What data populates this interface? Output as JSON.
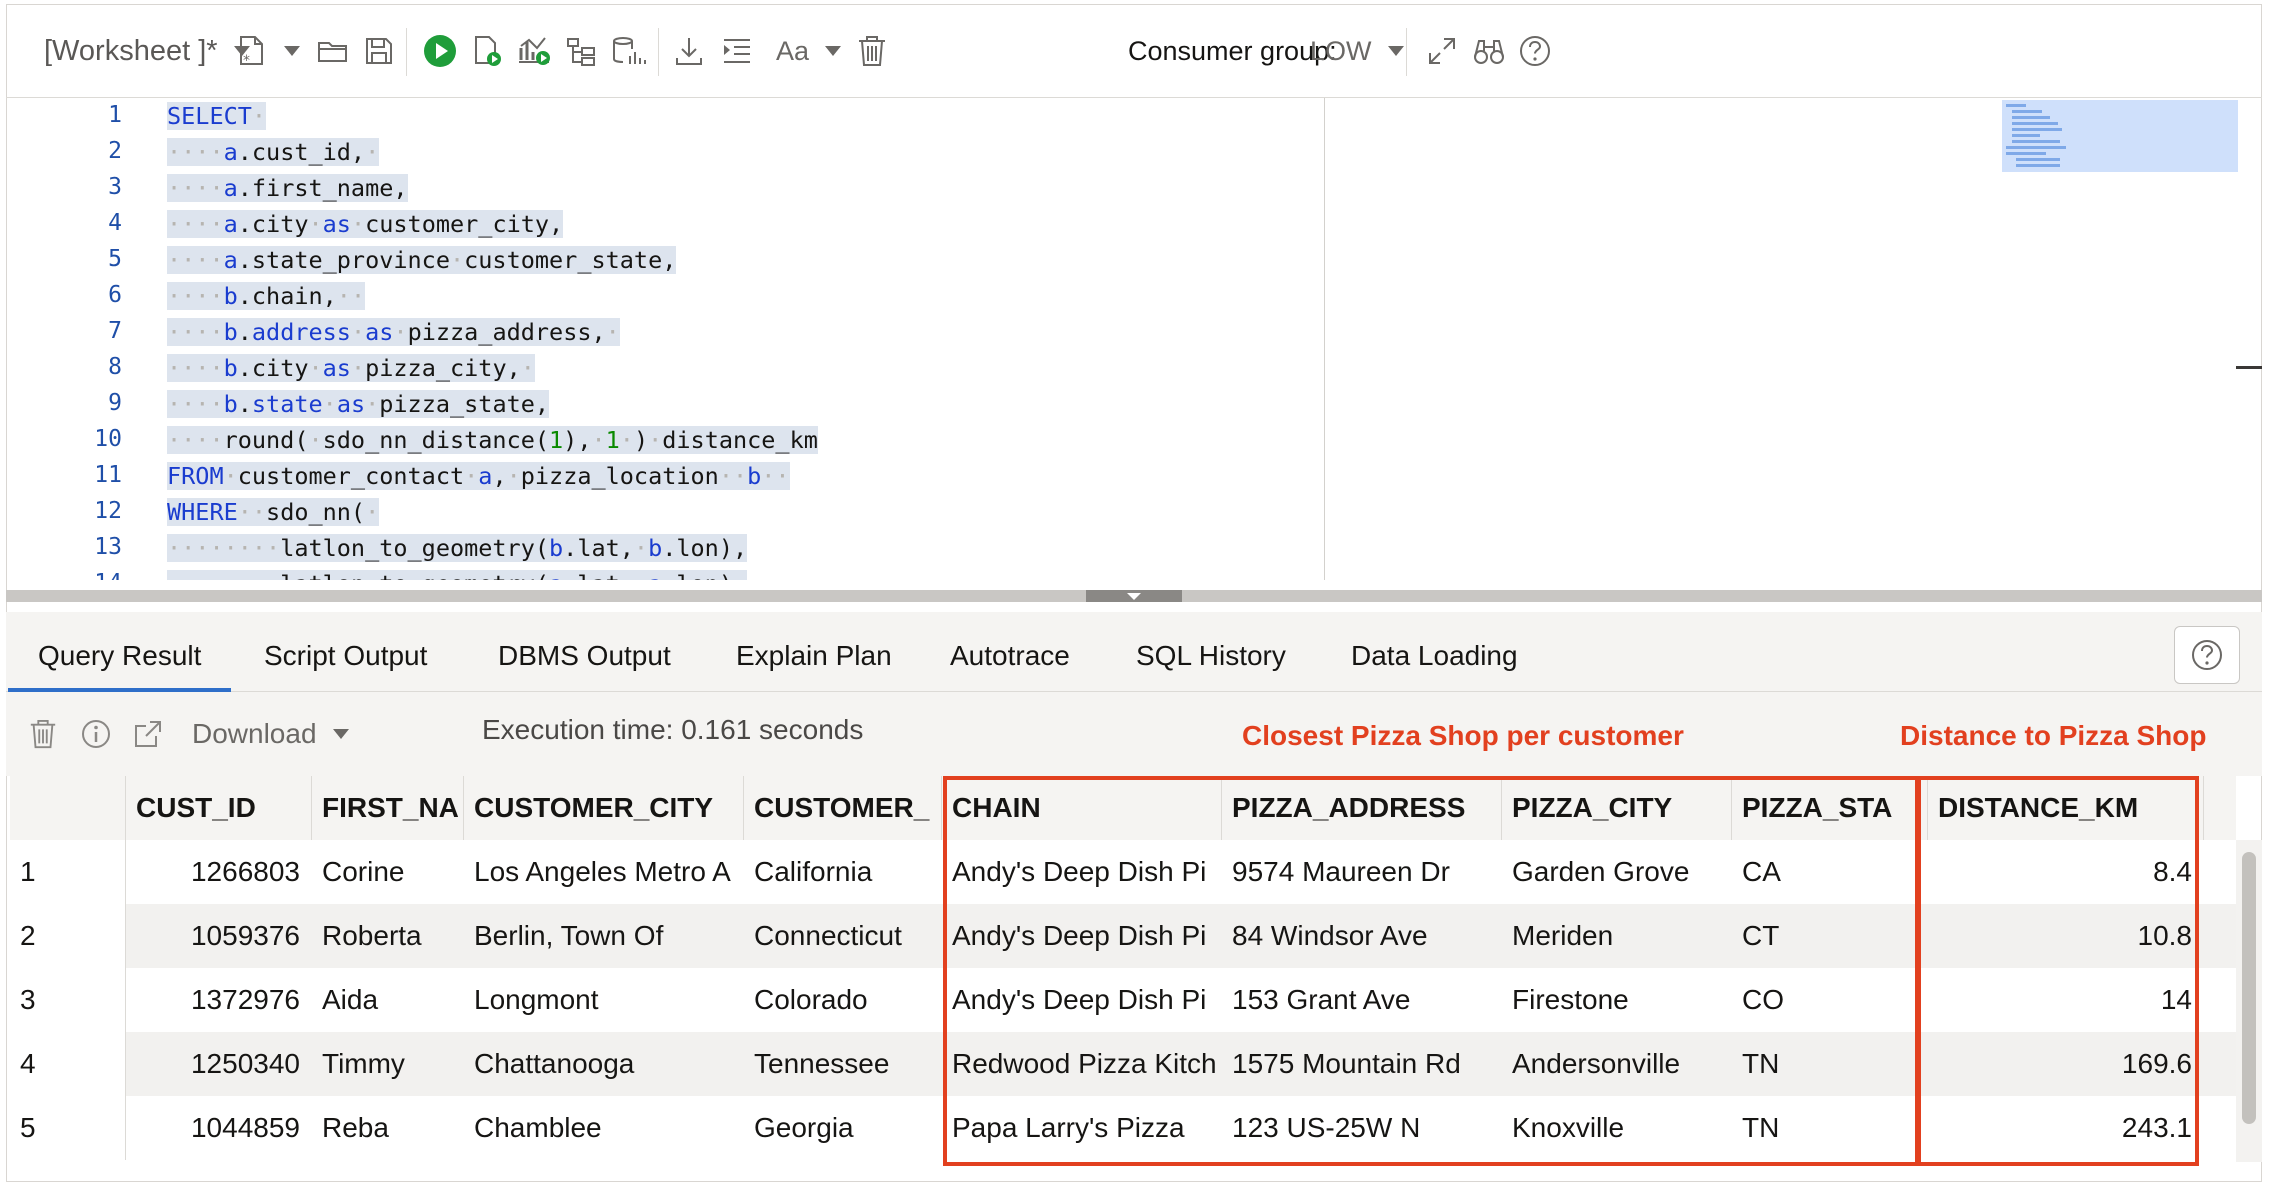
{
  "toolbar": {
    "worksheet_label": "[Worksheet ]*",
    "consumer_group_label": "Consumer group:",
    "consumer_group_value": "LOW",
    "font_button": "Aa"
  },
  "editor": {
    "line_numbers": [
      "1",
      "2",
      "3",
      "4",
      "5",
      "6",
      "7",
      "8",
      "9",
      "10",
      "11",
      "12",
      "13",
      "14"
    ]
  },
  "tabs": [
    "Query Result",
    "Script Output",
    "DBMS Output",
    "Explain Plan",
    "Autotrace",
    "SQL History",
    "Data Loading"
  ],
  "result_toolbar": {
    "download_label": "Download",
    "execution_time": "Execution time: 0.161 seconds"
  },
  "annotations": {
    "closest": "Closest Pizza Shop per customer",
    "distance": "Distance to Pizza Shop"
  },
  "grid": {
    "columns": [
      "CUST_ID",
      "FIRST_NA",
      "CUSTOMER_CITY",
      "CUSTOMER_",
      "CHAIN",
      "PIZZA_ADDRESS",
      "PIZZA_CITY",
      "PIZZA_STA",
      "DISTANCE_KM"
    ],
    "rows": [
      [
        "1",
        "1266803",
        "Corine",
        "Los Angeles Metro A",
        "California",
        "Andy's Deep Dish Pi",
        "9574 Maureen Dr",
        "Garden Grove",
        "CA",
        "8.4"
      ],
      [
        "2",
        "1059376",
        "Roberta",
        "Berlin, Town Of",
        "Connecticut",
        "Andy's Deep Dish Pi",
        "84 Windsor Ave",
        "Meriden",
        "CT",
        "10.8"
      ],
      [
        "3",
        "1372976",
        "Aida",
        "Longmont",
        "Colorado",
        "Andy's Deep Dish Pi",
        "153 Grant Ave",
        "Firestone",
        "CO",
        "14"
      ],
      [
        "4",
        "1250340",
        "Timmy",
        "Chattanooga",
        "Tennessee",
        "Redwood Pizza Kitch",
        "1575 Mountain Rd",
        "Andersonville",
        "TN",
        "169.6"
      ],
      [
        "5",
        "1044859",
        "Reba",
        "Chamblee",
        "Georgia",
        "Papa Larry's Pizza",
        "123 US-25W N",
        "Knoxville",
        "TN",
        "243.1"
      ]
    ]
  },
  "colors": {
    "accent": "#2e6ec9",
    "annotation": "#e2401f",
    "run": "#1f9d3a",
    "selection": "#dde4ee"
  }
}
